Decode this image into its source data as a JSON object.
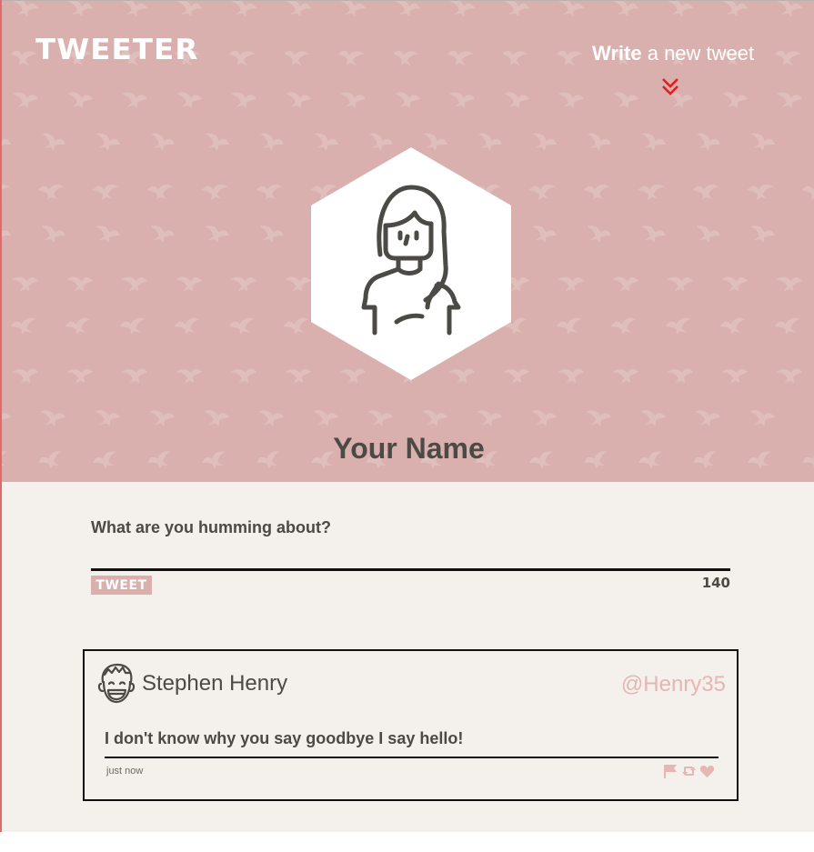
{
  "brand": {
    "logo_text": "TWEETER"
  },
  "nav": {
    "compose_bold": "Write",
    "compose_rest": " a new tweet",
    "chevron_icon": "chevrons-down-icon"
  },
  "profile": {
    "name": "Your Name",
    "avatar_icon": "woman-avatar-icon"
  },
  "composer": {
    "label": "What are you humming about?",
    "textarea_value": "",
    "submit_label": "TWEET",
    "char_count": "140"
  },
  "tweets": [
    {
      "author_name": "Stephen Henry",
      "handle": "@Henry35",
      "text": "I don't know why you say goodbye I say hello!",
      "timestamp": "just now",
      "avatar_icon": "smiling-man-avatar-icon",
      "actions": [
        "flag-icon",
        "retweet-icon",
        "heart-icon"
      ]
    }
  ],
  "colors": {
    "hero_background": "#d9b0ae",
    "page_background": "#f4f0eb",
    "text_dark": "#4b4a45",
    "accent_pink": "#e5b6b3",
    "chevron_red": "#e41e1e"
  }
}
